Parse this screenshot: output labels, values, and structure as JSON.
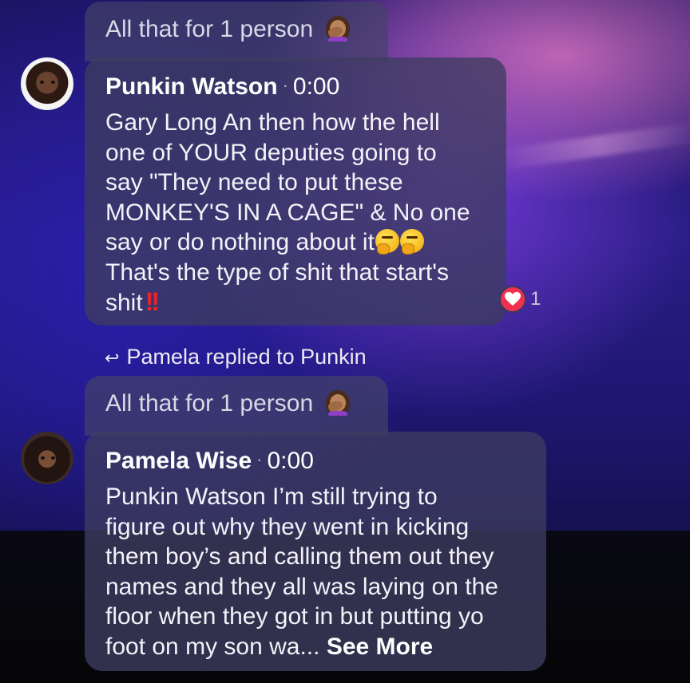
{
  "top_reply_preview": {
    "text": "All that for 1 person",
    "emoji": "woman-facepalming-medium-skin-tone"
  },
  "comment_1": {
    "author": "Punkin Watson",
    "timestamp": "0:00",
    "lines": [
      "Gary Long  An then how the hell",
      "one of YOUR deputies going to",
      "say \"They need to put these",
      "MONKEY'S IN A CAGE\" & No one",
      "say or do nothing about it",
      "That's the type of shit that start's",
      "shit"
    ],
    "emojis": [
      "thinking-face",
      "thinking-face",
      "double-exclamation-mark"
    ],
    "reaction": {
      "icon": "heart-icon",
      "count": "1",
      "color": "#f0304f"
    }
  },
  "replied_notice": {
    "text": "Pamela replied to Punkin",
    "icon": "reply-arrow-icon"
  },
  "second_reply_preview": {
    "text": "All that for 1 person",
    "emoji": "woman-facepalming-medium-skin-tone"
  },
  "comment_2": {
    "author": "Pamela Wise",
    "timestamp": "0:00",
    "lines": [
      "Punkin Watson  I’m still trying to",
      "figure out why they went in kicking",
      "them boy’s and calling them out they",
      "names and they all was laying on the",
      "floor when they got in but putting yo",
      "foot on my son wa..."
    ],
    "see_more": "See More"
  }
}
